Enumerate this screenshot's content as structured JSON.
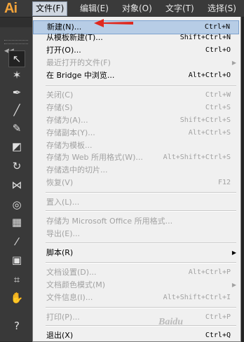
{
  "app": {
    "logo": "Ai"
  },
  "menubar": {
    "items": [
      {
        "label": "文件(F)"
      },
      {
        "label": "编辑(E)"
      },
      {
        "label": "对象(O)"
      },
      {
        "label": "文字(T)"
      },
      {
        "label": "选择(S)"
      }
    ]
  },
  "toolbox": {
    "collapse_glyph": "◀◀",
    "tools": [
      {
        "name": "selection-tool-icon",
        "glyph": "↖",
        "selected": true
      },
      {
        "name": "magic-wand-icon",
        "glyph": "✶"
      },
      {
        "name": "pen-tool-icon",
        "glyph": "✒"
      },
      {
        "name": "line-tool-icon",
        "glyph": "╱"
      },
      {
        "name": "paintbrush-icon",
        "glyph": "✎"
      },
      {
        "name": "eraser-icon",
        "glyph": "◩"
      },
      {
        "name": "rotate-icon",
        "glyph": "↻"
      },
      {
        "name": "width-tool-icon",
        "glyph": "⋈"
      },
      {
        "name": "shape-builder-icon",
        "glyph": "◎"
      },
      {
        "name": "mesh-icon",
        "glyph": "▦"
      },
      {
        "name": "eyedropper-icon",
        "glyph": "⁄"
      },
      {
        "name": "symbol-sprayer-icon",
        "glyph": "▣"
      },
      {
        "name": "artboard-icon",
        "glyph": "⌗"
      },
      {
        "name": "hand-icon",
        "glyph": "✋"
      },
      {
        "name": "help-icon",
        "glyph": "?"
      }
    ]
  },
  "file_menu": {
    "items": [
      {
        "label": "新建(N)...",
        "shortcut": "Ctrl+N",
        "enabled": true,
        "highlighted": true
      },
      {
        "label": "从模板新建(T)...",
        "shortcut": "Shift+Ctrl+N",
        "enabled": true
      },
      {
        "label": "打开(O)...",
        "shortcut": "Ctrl+O",
        "enabled": true
      },
      {
        "label": "最近打开的文件(F)",
        "shortcut": "",
        "enabled": false,
        "submenu": true
      },
      {
        "label": "在 Bridge 中浏览...",
        "shortcut": "Alt+Ctrl+O",
        "enabled": true
      },
      {
        "label": "关闭(C)",
        "shortcut": "Ctrl+W",
        "enabled": false
      },
      {
        "label": "存储(S)",
        "shortcut": "Ctrl+S",
        "enabled": false
      },
      {
        "label": "存储为(A)...",
        "shortcut": "Shift+Ctrl+S",
        "enabled": false
      },
      {
        "label": "存储副本(Y)...",
        "shortcut": "Alt+Ctrl+S",
        "enabled": false
      },
      {
        "label": "存储为模板...",
        "shortcut": "",
        "enabled": false
      },
      {
        "label": "存储为 Web 所用格式(W)...",
        "shortcut": "Alt+Shift+Ctrl+S",
        "enabled": false
      },
      {
        "label": "存储选中的切片...",
        "shortcut": "",
        "enabled": false
      },
      {
        "label": "恢复(V)",
        "shortcut": "F12",
        "enabled": false
      },
      {
        "label": "置入(L)...",
        "shortcut": "",
        "enabled": false
      },
      {
        "label": "存储为 Microsoft Office 所用格式...",
        "shortcut": "",
        "enabled": false
      },
      {
        "label": "导出(E)...",
        "shortcut": "",
        "enabled": false
      },
      {
        "label": "脚本(R)",
        "shortcut": "",
        "enabled": true,
        "submenu": true
      },
      {
        "label": "文档设置(D)...",
        "shortcut": "Alt+Ctrl+P",
        "enabled": false
      },
      {
        "label": "文档颜色模式(M)",
        "shortcut": "",
        "enabled": false,
        "submenu": true
      },
      {
        "label": "文件信息(I)...",
        "shortcut": "Alt+Shift+Ctrl+I",
        "enabled": false
      },
      {
        "label": "打印(P)...",
        "shortcut": "Ctrl+P",
        "enabled": false
      },
      {
        "label": "退出(X)",
        "shortcut": "Ctrl+Q",
        "enabled": true
      }
    ]
  },
  "watermark": "Baidu"
}
